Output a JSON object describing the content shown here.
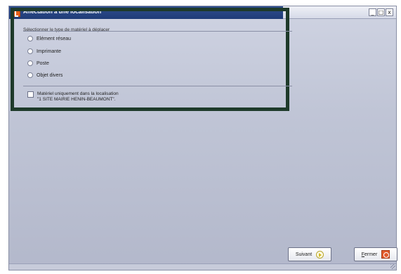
{
  "window": {
    "title": "Affectation à une localisation",
    "controls": [
      "_",
      "□",
      "x"
    ]
  },
  "group": {
    "label": "Sélectionner le type de matériel à déplacer",
    "options": [
      "Elément réseau",
      "Imprimante",
      "Poste",
      "Objet divers"
    ],
    "selected_index": -1
  },
  "checkbox": {
    "checked": false,
    "label_line1": "Matériel uniquement dans la localisation",
    "label_line2": "\"1 SITE MAIRIE HENIN-BEAUMONT\"."
  },
  "buttons": {
    "next_label": "Suivant",
    "close_label": "Fermer"
  },
  "icons": {
    "app": "app-icon",
    "next": "arrow-right-icon",
    "close": "close-icon"
  },
  "colors": {
    "accent": "#1f3b77",
    "highlight_border": "#1e3a2a",
    "close_icon": "#e25a2a"
  }
}
